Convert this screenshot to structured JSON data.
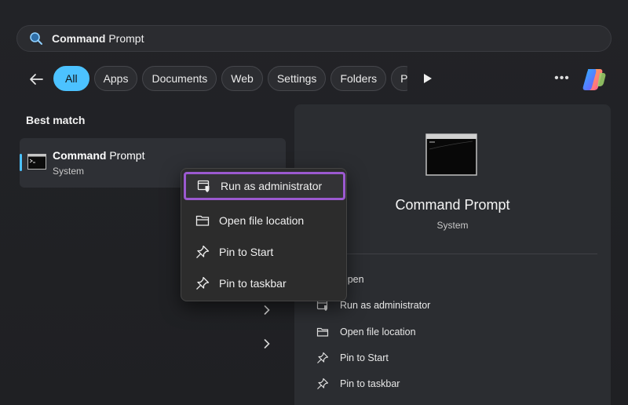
{
  "search": {
    "query_bold": "Command",
    "query_rest": " Prompt",
    "icon": "search-icon"
  },
  "filters": {
    "back_icon": "back-arrow-icon",
    "chips": [
      "All",
      "Apps",
      "Documents",
      "Web",
      "Settings",
      "Folders",
      "P"
    ],
    "active": "All",
    "play_icon": "play-icon",
    "more_label": "•••",
    "copilot_icon": "copilot-icon"
  },
  "best_match": {
    "label": "Best match",
    "item": {
      "title_bold": "Command",
      "title_rest": " Prompt",
      "subtitle": "System",
      "icon": "command-prompt-icon"
    }
  },
  "context_menu": {
    "items": [
      {
        "label": "Run as administrator",
        "icon": "shield-window-icon",
        "highlighted": true
      },
      {
        "label": "Open file location",
        "icon": "folder-icon"
      },
      {
        "label": "Pin to Start",
        "icon": "pin-icon"
      },
      {
        "label": "Pin to taskbar",
        "icon": "pin-icon"
      }
    ]
  },
  "detail_panel": {
    "title": "Command Prompt",
    "subtitle": "System",
    "icon": "command-prompt-icon",
    "actions": [
      {
        "label": "Open",
        "icon": "open-icon"
      },
      {
        "label": "Run as administrator",
        "icon": "shield-window-icon"
      },
      {
        "label": "Open file location",
        "icon": "folder-icon"
      },
      {
        "label": "Pin to Start",
        "icon": "pin-icon"
      },
      {
        "label": "Pin to taskbar",
        "icon": "pin-icon"
      }
    ]
  },
  "colors": {
    "accent": "#4cc2ff",
    "highlight_border": "#9b59d0",
    "background": "#202124"
  }
}
